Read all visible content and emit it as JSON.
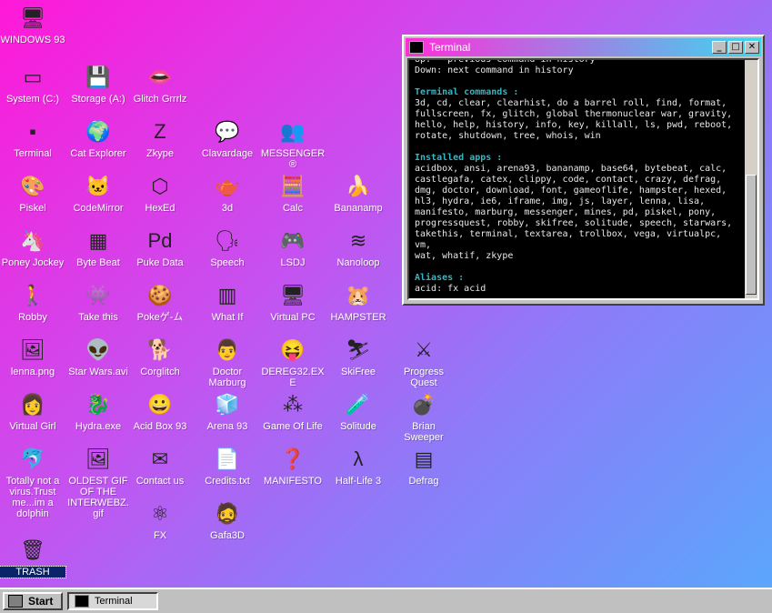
{
  "desktop_icons": [
    {
      "label": "WINDOWS 93",
      "glyph": "🖥",
      "icon": "computer-icon"
    },
    {
      "label": "System (C:)",
      "glyph": "▭",
      "icon": "drive-icon"
    },
    {
      "label": "Storage (A:)",
      "glyph": "💾",
      "icon": "floppy-icon"
    },
    {
      "label": "Glitch Grrrlz",
      "glyph": "👄",
      "icon": "lips-icon"
    },
    {
      "label": "Terminal",
      "glyph": "▪",
      "icon": "terminal-icon"
    },
    {
      "label": "Cat Explorer",
      "glyph": "🌍",
      "icon": "globe-icon"
    },
    {
      "label": "Zkype",
      "glyph": "Z",
      "icon": "zkype-icon"
    },
    {
      "label": "Clavardage",
      "glyph": "💬",
      "icon": "chat-icon"
    },
    {
      "label": "MESSENGER ®",
      "glyph": "👥",
      "icon": "messenger-icon"
    },
    {
      "label": "Piskel",
      "glyph": "🎨",
      "icon": "palette-icon"
    },
    {
      "label": "CodeMirror",
      "glyph": "🐱",
      "icon": "cat-icon"
    },
    {
      "label": "HexEd",
      "glyph": "⬡",
      "icon": "hex-icon"
    },
    {
      "label": "3d",
      "glyph": "🫖",
      "icon": "teapot-icon"
    },
    {
      "label": "Calc",
      "glyph": "🧮",
      "icon": "calculator-icon"
    },
    {
      "label": "Bananamp",
      "glyph": "🍌",
      "icon": "banana-icon"
    },
    {
      "label": "Poney Jockey",
      "glyph": "🦄",
      "icon": "pony-icon"
    },
    {
      "label": "Byte Beat",
      "glyph": "▦",
      "icon": "bytebeat-icon"
    },
    {
      "label": "Puke Data",
      "glyph": "Pd",
      "icon": "puredata-icon"
    },
    {
      "label": "Speech",
      "glyph": "🗣",
      "icon": "speech-icon"
    },
    {
      "label": "LSDJ",
      "glyph": "🎮",
      "icon": "gameboy-icon"
    },
    {
      "label": "Nanoloop",
      "glyph": "≋",
      "icon": "nanoloop-icon"
    },
    {
      "label": "Robby",
      "glyph": "🚶",
      "icon": "robot-icon"
    },
    {
      "label": "Take this",
      "glyph": "👾",
      "icon": "sprite-icon"
    },
    {
      "label": "Pokeゲ-ム",
      "glyph": "🍪",
      "icon": "cookie-icon"
    },
    {
      "label": "What If",
      "glyph": "▥",
      "icon": "whatif-icon"
    },
    {
      "label": "Virtual PC",
      "glyph": "🖥",
      "icon": "virtualpc-icon"
    },
    {
      "label": "HAMPSTER",
      "glyph": "🐹",
      "icon": "hamster-icon"
    },
    {
      "label": "lenna.png",
      "glyph": "🖼",
      "icon": "image-file-icon"
    },
    {
      "label": "Star Wars.avi",
      "glyph": "👽",
      "icon": "yoda-icon"
    },
    {
      "label": "Corglitch",
      "glyph": "🐕",
      "icon": "corgi-icon"
    },
    {
      "label": "Doctor Marburg",
      "glyph": "👨",
      "icon": "doctor-icon"
    },
    {
      "label": "DEREG32.EXE",
      "glyph": "😝",
      "icon": "dereg-icon"
    },
    {
      "label": "SkiFree",
      "glyph": "⛷",
      "icon": "skifree-icon"
    },
    {
      "label": "Progress Quest",
      "glyph": "⚔",
      "icon": "swords-icon"
    },
    {
      "label": "Virtual Girl",
      "glyph": "👩",
      "icon": "face-icon"
    },
    {
      "label": "Hydra.exe",
      "glyph": "🐉",
      "icon": "hydra-icon"
    },
    {
      "label": "Acid Box 93",
      "glyph": "😀",
      "icon": "smiley-icon"
    },
    {
      "label": "Arena 93",
      "glyph": "🧊",
      "icon": "cube-icon"
    },
    {
      "label": "Game Of Life",
      "glyph": "⁂",
      "icon": "gameoflife-icon"
    },
    {
      "label": "Solitude",
      "glyph": "🧪",
      "icon": "bottle-icon"
    },
    {
      "label": "Brian Sweeper",
      "glyph": "💣",
      "icon": "mine-icon"
    },
    {
      "label": "Totally not a virus.Trust me...im a dolphin",
      "glyph": "🐬",
      "icon": "dolphin-icon"
    },
    {
      "label": "OLDEST GIF OF THE INTERWEBZ.gif",
      "glyph": "🖼",
      "icon": "gif-file-icon"
    },
    {
      "label": "Contact us",
      "glyph": "✉",
      "icon": "contact-icon"
    },
    {
      "label": "Credits.txt",
      "glyph": "📄",
      "icon": "text-file-icon"
    },
    {
      "label": "MANIFESTO",
      "glyph": "❓",
      "icon": "question-icon"
    },
    {
      "label": "Half-Life 3",
      "glyph": "λ",
      "icon": "lambda-icon"
    },
    {
      "label": "Defrag",
      "glyph": "▤",
      "icon": "defrag-icon"
    },
    {
      "label": "FX",
      "glyph": "⚛",
      "icon": "atom-icon"
    },
    {
      "label": "Gafa3D",
      "glyph": "🧔",
      "icon": "gafa-icon"
    },
    {
      "label": "TRASH",
      "glyph": "🗑",
      "icon": "trash-icon"
    }
  ],
  "terminal": {
    "title": "Terminal",
    "lines": [
      {
        "text": "Up:   previous command in history",
        "kind": "text"
      },
      {
        "text": "Down: next command in history",
        "kind": "text"
      },
      {
        "text": "",
        "kind": "text"
      },
      {
        "text": "Terminal commands :",
        "kind": "head"
      },
      {
        "text": "3d, cd, clear, clearhist, do a barrel roll, find, format,\nfullscreen, fx, glitch, global thermonuclear war, gravity,\nhello, help, history, info, key, killall, ls, pwd, reboot,\nrotate, shutdown, tree, whois, win",
        "kind": "text"
      },
      {
        "text": "",
        "kind": "text"
      },
      {
        "text": "Installed apps :",
        "kind": "head"
      },
      {
        "text": "acidbox, ansi, arena93, bananamp, base64, bytebeat, calc,\ncastlegafa, catex, clippy, code, contact, crazy, defrag,\ndmg, doctor, download, font, gameoflife, hampster, hexed,\nhl3, hydra, ie6, iframe, img, js, layer, lenna, lisa,\nmanifesto, marburg, messenger, mines, pd, piskel, pony,\nprogressquest, robby, skifree, solitude, speech, starwars,\ntakethis, terminal, textarea, trollbox, vega, virtualpc, vm,\nwat, whatif, zkype",
        "kind": "text"
      },
      {
        "text": "",
        "kind": "text"
      },
      {
        "text": "Aliases :",
        "kind": "head"
      },
      {
        "text": "acid: fx acid",
        "kind": "text"
      },
      {
        "text": "",
        "kind": "text"
      },
      {
        "text": ">~",
        "kind": "text"
      }
    ]
  },
  "taskbar": {
    "start_label": "Start",
    "tasks": [
      {
        "label": "Terminal"
      }
    ]
  },
  "colors": {
    "desktop_gradient_start": "#ff18d8",
    "desktop_gradient_end": "#58a8fc",
    "terminal_heading": "#2fb9c8",
    "titlebar_start": "#ff2ed9",
    "titlebar_end": "#3ad8f0"
  }
}
